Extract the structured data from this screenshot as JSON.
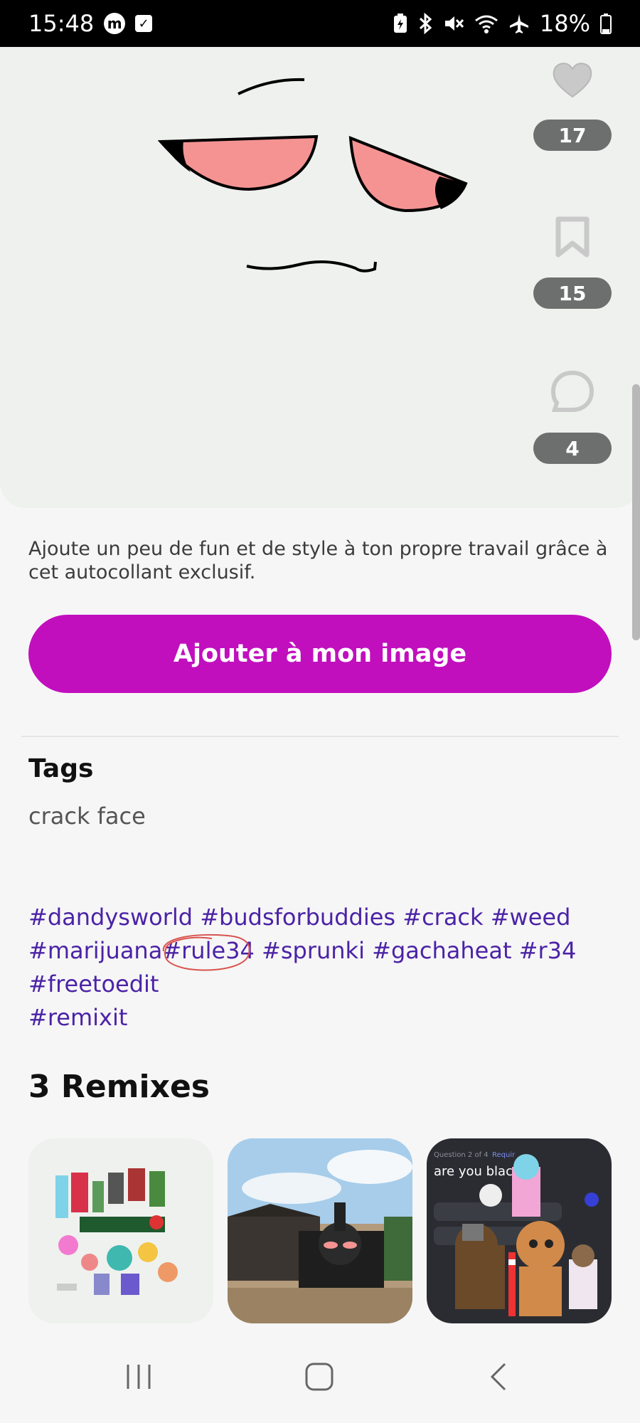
{
  "status_bar": {
    "time": "15:48",
    "battery": "18%",
    "icons": [
      "m-app-icon",
      "checkbox-icon",
      "battery-saver-icon",
      "bluetooth-icon",
      "mute-icon",
      "wifi-icon",
      "airplane-icon",
      "battery-icon"
    ]
  },
  "actions": {
    "likes": "17",
    "saves": "15",
    "comments": "4"
  },
  "description": "Ajoute un peu de fun et de style à ton propre travail grâce à cet autocollant exclusif.",
  "cta_label": "Ajouter à mon image",
  "tags": {
    "title": "Tags",
    "text": "crack face",
    "hashtags": [
      "#dandysworld",
      "#budsforbuddies",
      "#crack",
      "#weed",
      "#marijuana",
      "#rule34",
      "#sprunki",
      "#gachaheat",
      "#r34",
      "#freetoedit",
      "#remixit"
    ]
  },
  "remixes": {
    "title": "3 Remixes",
    "thumb_text": {
      "third_question": "Question 2 of 4",
      "third_require": "Requir",
      "third_prompt": "are you black?"
    }
  },
  "colors": {
    "accent": "#c10fbe",
    "hashtag": "#4b23a6",
    "pill": "#6d6f6e"
  }
}
